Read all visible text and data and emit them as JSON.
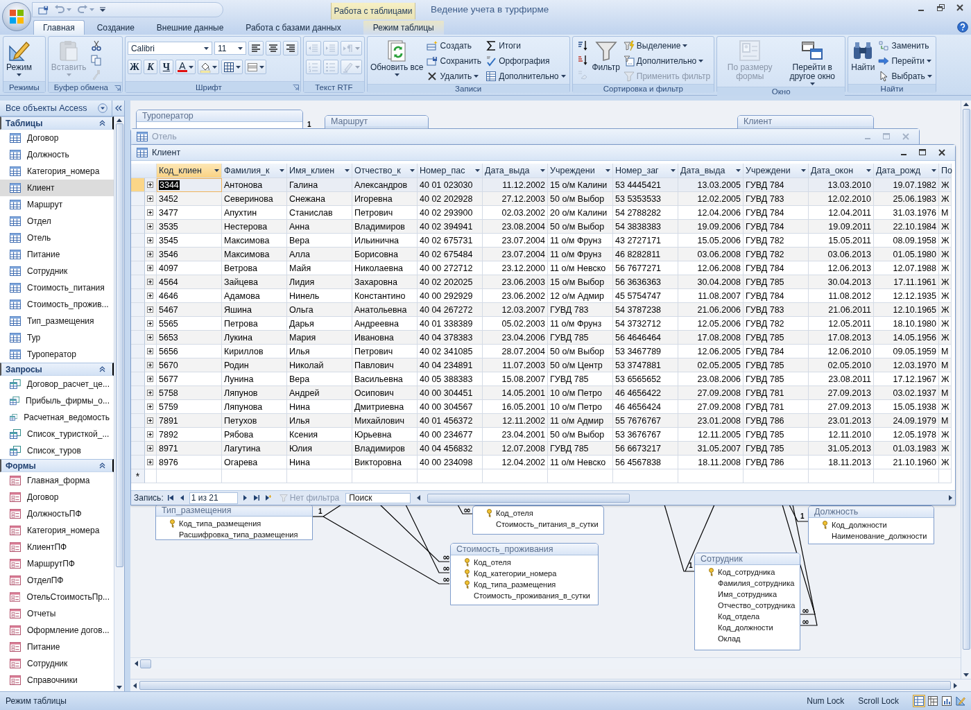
{
  "title_bar": {
    "contextual_label": "Работа с таблицами",
    "title": "Ведение учета в турфирме"
  },
  "tabs": [
    {
      "label": "Главная",
      "selected": true,
      "kind": "normal"
    },
    {
      "label": "Создание",
      "selected": false,
      "kind": "normal"
    },
    {
      "label": "Внешние данные",
      "selected": false,
      "kind": "normal"
    },
    {
      "label": "Работа с базами данных",
      "selected": false,
      "kind": "normal"
    },
    {
      "label": "Режим таблицы",
      "selected": false,
      "kind": "contextual"
    }
  ],
  "ribbon": {
    "groups": [
      {
        "label": "Режимы",
        "launcher": false,
        "kind": "stack",
        "controls": [
          {
            "kind": "large",
            "label": "Режим",
            "menu": true,
            "disabled": false
          }
        ]
      },
      {
        "label": "Буфер обмена",
        "launcher": true,
        "kind": "stack",
        "controls": [
          {
            "kind": "large",
            "label": "Вставить",
            "menu": true,
            "disabled": true
          },
          {
            "kind": "icon",
            "menu": false,
            "disabled": false
          },
          {
            "kind": "icon",
            "menu": false,
            "disabled": false
          },
          {
            "kind": "icon",
            "menu": false,
            "disabled": true
          }
        ]
      },
      {
        "label": "Шрифт",
        "launcher": true,
        "kind": "rows",
        "rows": [
          {
            "controls": [
              {
                "kind": "combo",
                "value": "Calibri",
                "menu": true,
                "disabled": false
              },
              {
                "kind": "combo",
                "value": "11",
                "menu": true,
                "disabled": false
              },
              {
                "kind": "icon",
                "menu": false,
                "disabled": false
              },
              {
                "kind": "icon",
                "menu": false,
                "disabled": false
              },
              {
                "kind": "icon",
                "menu": false,
                "disabled": false
              }
            ]
          },
          {
            "controls": [
              {
                "kind": "bold",
                "label": "Ж",
                "menu": false,
                "disabled": false
              },
              {
                "kind": "italic",
                "label": "К",
                "menu": false,
                "disabled": false
              },
              {
                "kind": "underline",
                "label": "Ч",
                "menu": false,
                "disabled": false
              },
              {
                "kind": "fontcolor",
                "label": "A",
                "menu": true,
                "disabled": false
              },
              {
                "kind": "icon",
                "menu": true,
                "disabled": false
              },
              {
                "kind": "icon",
                "menu": true,
                "disabled": false
              },
              {
                "kind": "icon",
                "menu": true,
                "disabled": false
              }
            ]
          }
        ]
      },
      {
        "label": "Текст RTF",
        "launcher": false,
        "kind": "rows",
        "rows": [
          {
            "controls": [
              {
                "kind": "icon",
                "menu": false,
                "disabled": true
              },
              {
                "kind": "icon",
                "menu": false,
                "disabled": true
              },
              {
                "kind": "icon",
                "menu": true,
                "disabled": true
              }
            ]
          },
          {
            "controls": [
              {
                "kind": "icon",
                "menu": false,
                "disabled": true
              },
              {
                "kind": "icon",
                "menu": false,
                "disabled": true
              },
              {
                "kind": "icon",
                "menu": true,
                "disabled": true
              }
            ]
          }
        ]
      },
      {
        "label": "Записи",
        "launcher": false,
        "kind": "stack",
        "controls": [
          {
            "kind": "large",
            "label": "Обновить все",
            "menu": true,
            "disabled": false
          },
          {
            "kind": "small",
            "label": "Создать",
            "menu": false,
            "disabled": false
          },
          {
            "kind": "small",
            "label": "Сохранить",
            "menu": false,
            "disabled": false
          },
          {
            "kind": "small",
            "label": "Удалить",
            "menu": true,
            "disabled": false
          },
          {
            "kind": "small",
            "label": "Итоги",
            "menu": false,
            "disabled": false
          },
          {
            "kind": "small",
            "label": "Орфография",
            "menu": false,
            "disabled": false
          },
          {
            "kind": "small",
            "label": "Дополнительно",
            "menu": true,
            "disabled": false
          }
        ]
      },
      {
        "label": "Сортировка и фильтр",
        "launcher": false,
        "kind": "stack",
        "controls": [
          {
            "kind": "icon",
            "menu": false,
            "disabled": false
          },
          {
            "kind": "icon",
            "menu": false,
            "disabled": false
          },
          {
            "kind": "icon",
            "menu": false,
            "disabled": true
          },
          {
            "kind": "large",
            "label": "Фильтр",
            "menu": false,
            "disabled": false
          },
          {
            "kind": "small",
            "label": "Выделение",
            "menu": true,
            "disabled": false
          },
          {
            "kind": "small",
            "label": "Дополнительно",
            "menu": true,
            "disabled": false
          },
          {
            "kind": "small",
            "label": "Применить фильтр",
            "menu": false,
            "disabled": true
          }
        ]
      },
      {
        "label": "Окно",
        "launcher": false,
        "kind": "stack",
        "controls": [
          {
            "kind": "large",
            "label": "По размеру формы",
            "menu": false,
            "disabled": true
          },
          {
            "kind": "large",
            "label": "Перейти в другое окно",
            "menu": true,
            "disabled": false
          }
        ]
      },
      {
        "label": "Найти",
        "launcher": false,
        "kind": "stack",
        "controls": [
          {
            "kind": "large",
            "label": "Найти",
            "menu": false,
            "disabled": false
          },
          {
            "kind": "small",
            "label": "Заменить",
            "menu": false,
            "disabled": false
          },
          {
            "kind": "small",
            "label": "Перейти",
            "menu": true,
            "disabled": false
          },
          {
            "kind": "small",
            "label": "Выбрать",
            "menu": true,
            "disabled": false
          }
        ]
      }
    ]
  },
  "nav": {
    "title": "Все объекты Access",
    "sections": [
      {
        "label": "Таблицы",
        "kind": "table",
        "expanded": true,
        "items": [
          {
            "label": "Договор",
            "selected": false
          },
          {
            "label": "Должность",
            "selected": false
          },
          {
            "label": "Категория_номера",
            "selected": false
          },
          {
            "label": "Клиент",
            "selected": true
          },
          {
            "label": "Маршрут",
            "selected": false
          },
          {
            "label": "Отдел",
            "selected": false
          },
          {
            "label": "Отель",
            "selected": false
          },
          {
            "label": "Питание",
            "selected": false
          },
          {
            "label": "Сотрудник",
            "selected": false
          },
          {
            "label": "Стоимость_питания",
            "selected": false
          },
          {
            "label": "Стоимость_прожив...",
            "selected": false
          },
          {
            "label": "Тип_размещения",
            "selected": false
          },
          {
            "label": "Тур",
            "selected": false
          },
          {
            "label": "Туроператор",
            "selected": false
          }
        ]
      },
      {
        "label": "Запросы",
        "kind": "query",
        "expanded": true,
        "items": [
          {
            "label": "Договор_расчет_це...",
            "selected": false
          },
          {
            "label": "Прибыль_фирмы_о...",
            "selected": false
          },
          {
            "label": "Расчетная_ведомость",
            "selected": false
          },
          {
            "label": "Список_туристкой_...",
            "selected": false
          },
          {
            "label": "Список_туров",
            "selected": false
          }
        ]
      },
      {
        "label": "Формы",
        "kind": "form",
        "expanded": true,
        "items": [
          {
            "label": "Главная_форма",
            "selected": false
          },
          {
            "label": "Договор",
            "selected": false
          },
          {
            "label": "ДолжностьПФ",
            "selected": false
          },
          {
            "label": "Категория_номера",
            "selected": false
          },
          {
            "label": "КлиентПФ",
            "selected": false
          },
          {
            "label": "МаршрутПФ",
            "selected": false
          },
          {
            "label": "ОтделПФ",
            "selected": false
          },
          {
            "label": "ОтельСтоимостьПр...",
            "selected": false
          },
          {
            "label": "Отчеты",
            "selected": false
          },
          {
            "label": "Оформление догов...",
            "selected": false
          },
          {
            "label": "Питание",
            "selected": false
          },
          {
            "label": "Сотрудник",
            "selected": false
          },
          {
            "label": "Справочники",
            "selected": false
          }
        ]
      }
    ]
  },
  "diagram": {
    "tables": [
      {
        "title": "Туроператор"
      },
      {
        "title": "Маршрут"
      },
      {
        "title": "Клиент"
      },
      {
        "title": "Тип_размещения",
        "fields": [
          {
            "name": "Код_типа_размещения",
            "key": true
          },
          {
            "name": "Расшифровка_типа_размещения",
            "key": false
          }
        ]
      },
      {
        "fields": [
          {
            "name": "Код_отеля",
            "key": true
          },
          {
            "name": "Стоимость_питания_в_сутки",
            "key": false
          }
        ]
      },
      {
        "title": "Стоимость_проживания",
        "fields": [
          {
            "name": "Код_отеля",
            "key": true
          },
          {
            "name": "Код_категории_номера",
            "key": true
          },
          {
            "name": "Код_типа_размещения",
            "key": true
          },
          {
            "name": "Стоимость_проживания_в_сутки",
            "key": false
          }
        ]
      },
      {
        "title": "Должность",
        "fields": [
          {
            "name": "Код_должности",
            "key": true
          },
          {
            "name": "Наименование_должности",
            "key": false
          }
        ]
      },
      {
        "title": "Сотрудник",
        "fields": [
          {
            "name": "Код_сотрудника",
            "key": true
          },
          {
            "name": "Фамилия_сотрудника",
            "key": false
          },
          {
            "name": "Имя_сотрудника",
            "key": false
          },
          {
            "name": "Отчество_сотрудника",
            "key": false
          },
          {
            "name": "Код_отдела",
            "key": false
          },
          {
            "name": "Код_должности",
            "key": false
          },
          {
            "name": "Оклад",
            "key": false
          }
        ]
      }
    ],
    "relations": [
      {
        "kind": "one",
        "label": "1"
      },
      {
        "kind": "many",
        "label": "∞"
      },
      {
        "kind": "one",
        "label": "1"
      },
      {
        "kind": "one",
        "label": "1"
      },
      {
        "kind": "many",
        "label": "∞"
      },
      {
        "kind": "one",
        "label": "1"
      },
      {
        "kind": "many",
        "label": "∞"
      },
      {
        "kind": "many",
        "label": "∞"
      },
      {
        "kind": "many",
        "label": "∞"
      },
      {
        "kind": "many",
        "label": "∞"
      }
    ]
  },
  "background_window": {
    "title": "Отель"
  },
  "datasheet": {
    "title": "Клиент",
    "columns": [
      {
        "label": "Код_клиен",
        "kind": "text",
        "selected": true
      },
      {
        "label": "Фамилия_к",
        "kind": "text",
        "selected": false
      },
      {
        "label": "Имя_клиен",
        "kind": "text",
        "selected": false
      },
      {
        "label": "Отчество_к",
        "kind": "text",
        "selected": false
      },
      {
        "label": "Номер_пас",
        "kind": "text",
        "selected": false
      },
      {
        "label": "Дата_выда",
        "kind": "date",
        "selected": false
      },
      {
        "label": "Учреждени",
        "kind": "text",
        "selected": false
      },
      {
        "label": "Номер_заг",
        "kind": "text",
        "selected": false
      },
      {
        "label": "Дата_выда",
        "kind": "date",
        "selected": false
      },
      {
        "label": "Учреждени",
        "kind": "text",
        "selected": false
      },
      {
        "label": "Дата_окон",
        "kind": "date",
        "selected": false
      },
      {
        "label": "Дата_рожд",
        "kind": "date",
        "selected": false
      },
      {
        "label": "По",
        "kind": "text",
        "selected": false
      }
    ],
    "rows": [
      {
        "selected": true,
        "cells": [
          "3344",
          "Антонова",
          "Галина",
          "Александров",
          "40 01 023030",
          "11.12.2002",
          "15 о/м Калини",
          "53 4445421",
          "13.03.2005",
          "ГУВД 784",
          "13.03.2010",
          "19.07.1982",
          "Ж"
        ]
      },
      {
        "selected": false,
        "cells": [
          "3452",
          "Северинова",
          "Снежана",
          "Игоревна",
          "40 02 202928",
          "27.12.2003",
          "50 о/м Выбор",
          "53 5353533",
          "12.02.2005",
          "ГУВД 783",
          "12.02.2010",
          "25.06.1983",
          "Ж"
        ]
      },
      {
        "selected": false,
        "cells": [
          "3477",
          "Апухтин",
          "Станислав",
          "Петрович",
          "40 02 293900",
          "02.03.2002",
          "20 о/м Калини",
          "54 2788282",
          "12.04.2006",
          "ГУВД 784",
          "12.04.2011",
          "31.03.1976",
          "М"
        ]
      },
      {
        "selected": false,
        "cells": [
          "3535",
          "Нестерова",
          "Анна",
          "Владимиров",
          "40 02 394941",
          "23.08.2004",
          "50 о/м Выбор",
          "54 3838383",
          "19.09.2006",
          "ГУВД 784",
          "19.09.2011",
          "22.10.1984",
          "Ж"
        ]
      },
      {
        "selected": false,
        "cells": [
          "3545",
          "Максимова",
          "Вера",
          "Ильинична",
          "40 02 675731",
          "23.07.2004",
          "11 о/м Фрунз",
          "43 2727171",
          "15.05.2006",
          "ГУВД 782",
          "15.05.2011",
          "08.09.1958",
          "Ж"
        ]
      },
      {
        "selected": false,
        "cells": [
          "3546",
          "Максимова",
          "Алла",
          "Борисовна",
          "40 02 675484",
          "23.07.2004",
          "11 о/м Фрунз",
          "46 8282811",
          "03.06.2008",
          "ГУВД 782",
          "03.06.2013",
          "01.05.1980",
          "Ж"
        ]
      },
      {
        "selected": false,
        "cells": [
          "4097",
          "Ветрова",
          "Майя",
          "Николаевна",
          "40 00 272712",
          "23.12.2000",
          "11 о/м Невско",
          "56 7677271",
          "12.06.2008",
          "ГУВД 784",
          "12.06.2013",
          "12.07.1988",
          "Ж"
        ]
      },
      {
        "selected": false,
        "cells": [
          "4564",
          "Зайцева",
          "Лидия",
          "Захаровна",
          "40 02 202025",
          "23.06.2003",
          "15 о/м Выбор",
          "56 3636363",
          "30.04.2008",
          "ГУВД 785",
          "30.04.2013",
          "17.11.1961",
          "Ж"
        ]
      },
      {
        "selected": false,
        "cells": [
          "4646",
          "Адамова",
          "Нинель",
          "Константино",
          "40 00 292929",
          "23.06.2002",
          "12 о/м Адмир",
          "45 5754747",
          "11.08.2007",
          "ГУВД 784",
          "11.08.2012",
          "12.12.1935",
          "Ж"
        ]
      },
      {
        "selected": false,
        "cells": [
          "5467",
          "Яшина",
          "Ольга",
          "Анатольевна",
          "40 04 267272",
          "12.03.2007",
          "ГУВД 783",
          "54 3787238",
          "21.06.2006",
          "ГУВД 783",
          "21.06.2011",
          "12.10.1965",
          "Ж"
        ]
      },
      {
        "selected": false,
        "cells": [
          "5565",
          "Петрова",
          "Дарья",
          "Андреевна",
          "40 01 338389",
          "05.02.2003",
          "11 о/м Фрунз",
          "54 3732712",
          "12.05.2006",
          "ГУВД 782",
          "12.05.2011",
          "18.10.1980",
          "Ж"
        ]
      },
      {
        "selected": false,
        "cells": [
          "5653",
          "Лукина",
          "Мария",
          "Ивановна",
          "40 04 378383",
          "23.04.2006",
          "ГУВД 785",
          "56 4646464",
          "17.08.2008",
          "ГУВД 785",
          "17.08.2013",
          "14.05.1956",
          "Ж"
        ]
      },
      {
        "selected": false,
        "cells": [
          "5656",
          "Кириллов",
          "Илья",
          "Петрович",
          "40 02 341085",
          "28.07.2004",
          "50 о/м Выбор",
          "53 3467789",
          "12.06.2005",
          "ГУВД 784",
          "12.06.2010",
          "09.05.1959",
          "М"
        ]
      },
      {
        "selected": false,
        "cells": [
          "5670",
          "Родин",
          "Николай",
          "Павлович",
          "40 04 234891",
          "11.07.2003",
          "50 о/м Центр",
          "53 3747881",
          "02.05.2005",
          "ГУВД 785",
          "02.05.2010",
          "12.03.1970",
          "М"
        ]
      },
      {
        "selected": false,
        "cells": [
          "5677",
          "Лунина",
          "Вера",
          "Васильевна",
          "40 05 388383",
          "15.08.2007",
          "ГУВД 785",
          "53 6565652",
          "23.08.2006",
          "ГУВД 785",
          "23.08.2011",
          "17.12.1967",
          "Ж"
        ]
      },
      {
        "selected": false,
        "cells": [
          "5758",
          "Ляпунов",
          "Андрей",
          "Осипович",
          "40 00 304451",
          "14.05.2001",
          "10 о/м Петро",
          "46 4656422",
          "27.09.2008",
          "ГУВД 781",
          "27.09.2013",
          "03.02.1937",
          "М"
        ]
      },
      {
        "selected": false,
        "cells": [
          "5759",
          "Ляпунова",
          "Нина",
          "Дмитриевна",
          "40 00 304567",
          "16.05.2001",
          "10 о/м Петро",
          "46 4656424",
          "27.09.2008",
          "ГУВД 781",
          "27.09.2013",
          "15.05.1938",
          "Ж"
        ]
      },
      {
        "selected": false,
        "cells": [
          "7891",
          "Петухов",
          "Илья",
          "Михайлович",
          "40 01 456372",
          "12.11.2002",
          "11 о/м Адмир",
          "55 7676767",
          "23.01.2008",
          "ГУВД 786",
          "23.01.2013",
          "24.09.1979",
          "М"
        ]
      },
      {
        "selected": false,
        "cells": [
          "7892",
          "Рябова",
          "Ксения",
          "Юрьевна",
          "40 00 234677",
          "23.04.2001",
          "50 о/м Выбор",
          "53 3676767",
          "12.11.2005",
          "ГУВД 785",
          "12.11.2010",
          "12.05.1978",
          "Ж"
        ]
      },
      {
        "selected": false,
        "cells": [
          "8971",
          "Лагутина",
          "Юлия",
          "Владимиров",
          "40 04 456832",
          "12.07.2008",
          "ГУВД 785",
          "56 6673217",
          "31.05.2007",
          "ГУВД 785",
          "31.05.2013",
          "01.03.1983",
          "Ж"
        ]
      },
      {
        "selected": false,
        "cells": [
          "8976",
          "Огарева",
          "Нина",
          "Викторовна",
          "40 00 234098",
          "12.04.2002",
          "11 о/м Невско",
          "56 4567838",
          "18.11.2008",
          "ГУВД 786",
          "18.11.2013",
          "21.10.1960",
          "Ж"
        ]
      }
    ],
    "new_row_marker": "*",
    "record_nav": {
      "label": "Запись:",
      "position": "1 из 21",
      "filter": "Нет фильтра",
      "search_placeholder": "Поиск"
    }
  },
  "status_bar": {
    "mode": "Режим таблицы",
    "indicators": [
      "Num Lock",
      "Scroll Lock"
    ]
  }
}
